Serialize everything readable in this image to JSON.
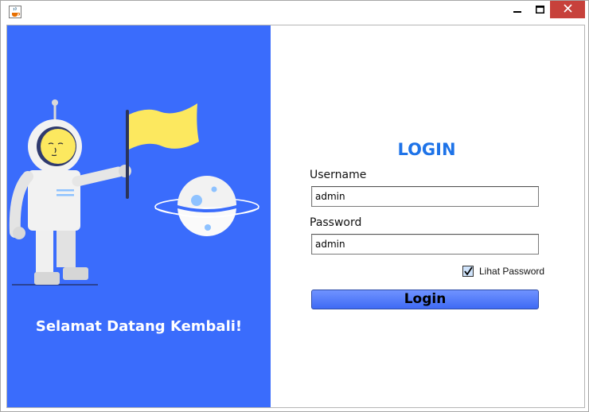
{
  "window": {
    "app_icon": "java-coffee-icon",
    "controls": {
      "minimize": "minimize-icon",
      "maximize": "maximize-icon",
      "close": "close-icon"
    }
  },
  "left_panel": {
    "welcome_text": "Selamat Datang Kembali!",
    "illustration": "astronaut-with-flag-and-planet",
    "colors": {
      "background": "#3a6cfc",
      "flag": "#fce85f",
      "helmet": "#f0f0f0",
      "planet_spots": "#8ec2ff"
    }
  },
  "form": {
    "title": "LOGIN",
    "username_label": "Username",
    "username_value": "admin",
    "password_label": "Password",
    "password_value": "admin",
    "show_password_label": "Lihat Password",
    "show_password_checked": true,
    "login_button": "Login",
    "colors": {
      "title": "#1e73e8",
      "button": "#4f78f8"
    }
  }
}
